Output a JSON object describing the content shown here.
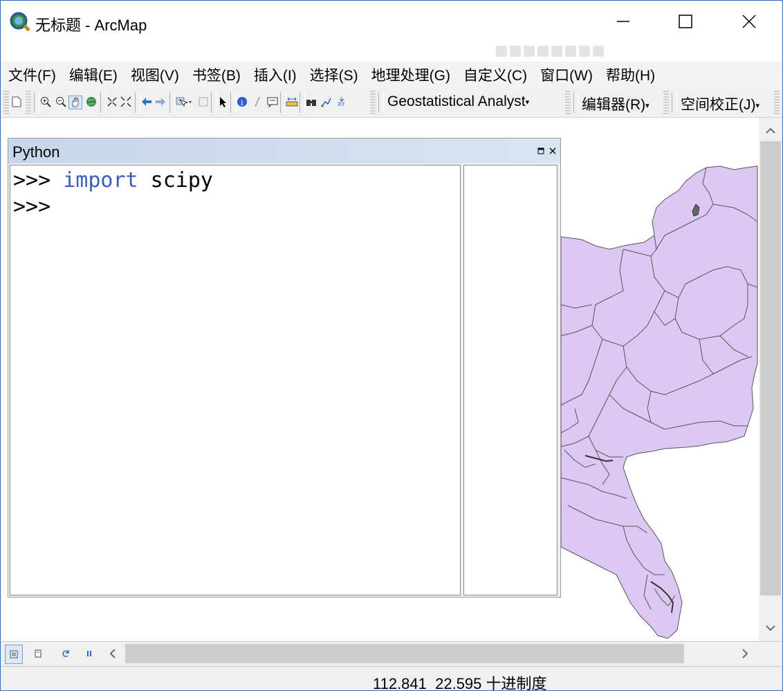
{
  "window": {
    "title": "无标题 - ArcMap"
  },
  "menu": {
    "items": [
      "文件(F)",
      "编辑(E)",
      "视图(V)",
      "书签(B)",
      "插入(I)",
      "选择(S)",
      "地理处理(G)",
      "自定义(C)",
      "窗口(W)",
      "帮助(H)"
    ]
  },
  "toolbar": {
    "geostatistical_label": "Geostatistical Analyst",
    "editor_label": "编辑器(R)",
    "spatial_adjust_label": "空间校正(J)",
    "dropdown_arrow": "▾"
  },
  "python_window": {
    "title": "Python",
    "lines": [
      {
        "prompt": ">>> ",
        "keyword": "import",
        "rest": " scipy"
      },
      {
        "prompt": ">>>",
        "keyword": "",
        "rest": ""
      }
    ]
  },
  "status": {
    "coordinates": "112.841  22.595 十进制度"
  },
  "colors": {
    "map_fill": "#dcc8f3",
    "map_stroke": "#555555",
    "python_keyword": "#3a5fb5",
    "python_header": "#c7d6ea"
  },
  "icons": [
    "app-icon",
    "minimize-icon",
    "maximize-icon",
    "close-icon",
    "new-document-icon",
    "zoom-in-icon",
    "zoom-out-icon",
    "pan-icon",
    "full-extent-icon",
    "fixed-zoom-in-icon",
    "fixed-zoom-out-icon",
    "back-icon",
    "forward-icon",
    "select-features-icon",
    "clear-selection-icon",
    "select-elements-icon",
    "identify-icon",
    "hyperlink-icon",
    "html-popup-icon",
    "measure-icon",
    "find-icon",
    "find-route-icon",
    "go-to-xy-icon"
  ]
}
